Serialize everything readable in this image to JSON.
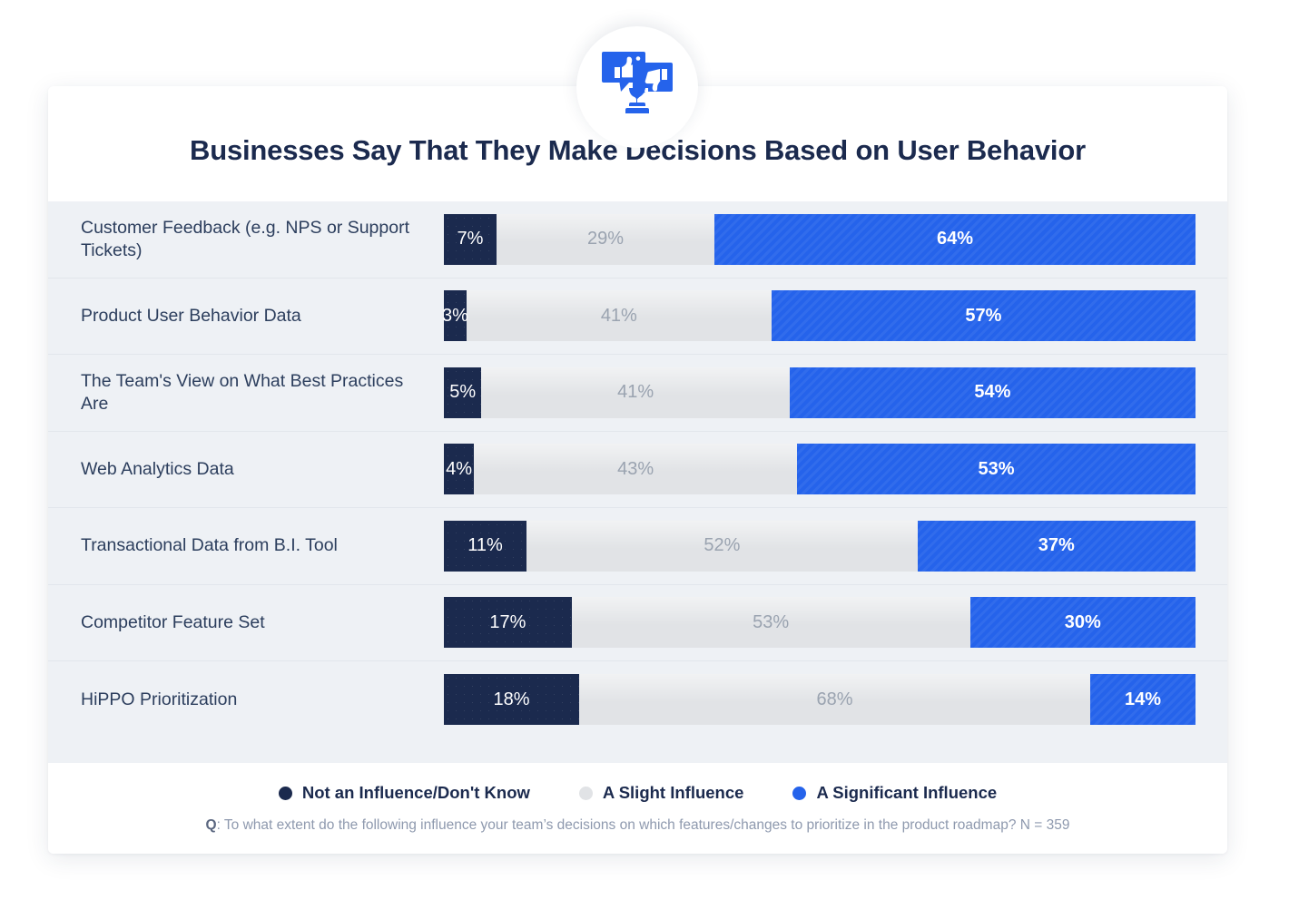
{
  "header": {
    "title": "Businesses Say That They Make Decisions Based on User Behavior",
    "badge_icon": "thumbs-up-down-feedback-icon"
  },
  "legend": {
    "items": [
      {
        "label": "Not an Influence/Don't Know",
        "color": "#1b2a4e",
        "icon": "legend-dot-not-an-influence"
      },
      {
        "label": "A Slight Influence",
        "color": "#e1e3e6",
        "icon": "legend-dot-slight-influence"
      },
      {
        "label": "A Significant Influence",
        "color": "#2563eb",
        "icon": "legend-dot-significant-influence"
      }
    ]
  },
  "footnote": {
    "prefix": "Q",
    "text": ": To what extent do the following influence your team’s decisions on which features/changes to prioritize in the product roadmap? N = 359"
  },
  "chart_data": {
    "type": "bar",
    "subtype": "stacked-horizontal-100",
    "title": "Businesses Say That They Make Decisions Based on User Behavior",
    "xlabel": "",
    "ylabel": "",
    "xlim": [
      0,
      100
    ],
    "grid": false,
    "legend_position": "bottom",
    "value_suffix": "%",
    "categories": [
      "Customer Feedback (e.g. NPS or Support Tickets)",
      "Product User Behavior Data",
      "The Team's View on What Best Practices Are",
      "Web Analytics Data",
      "Transactional Data from B.I. Tool",
      "Competitor Feature Set",
      "HiPPO Prioritization"
    ],
    "series": [
      {
        "name": "Not an Influence/Don't Know",
        "color": "#1b2a4e",
        "values": [
          7,
          3,
          5,
          4,
          11,
          17,
          18
        ]
      },
      {
        "name": "A Slight Influence",
        "color": "#e1e3e6",
        "values": [
          29,
          41,
          41,
          43,
          52,
          53,
          68
        ]
      },
      {
        "name": "A Significant Influence",
        "color": "#2563eb",
        "values": [
          64,
          57,
          54,
          53,
          37,
          30,
          14
        ]
      }
    ],
    "rows": [
      {
        "label": "Customer Feedback (e.g. NPS or Support Tickets)",
        "none": "7%",
        "slight": "29%",
        "significant": "64%",
        "none_v": 7,
        "slight_v": 29,
        "significant_v": 64
      },
      {
        "label": "Product User Behavior Data",
        "none": "3%",
        "slight": "41%",
        "significant": "57%",
        "none_v": 3,
        "slight_v": 41,
        "significant_v": 57
      },
      {
        "label": "The Team's View on What Best Practices Are",
        "none": "5%",
        "slight": "41%",
        "significant": "54%",
        "none_v": 5,
        "slight_v": 41,
        "significant_v": 54
      },
      {
        "label": "Web Analytics Data",
        "none": "4%",
        "slight": "43%",
        "significant": "53%",
        "none_v": 4,
        "slight_v": 43,
        "significant_v": 53
      },
      {
        "label": "Transactional Data from B.I. Tool",
        "none": "11%",
        "slight": "52%",
        "significant": "37%",
        "none_v": 11,
        "slight_v": 52,
        "significant_v": 37
      },
      {
        "label": "Competitor Feature Set",
        "none": "17%",
        "slight": "53%",
        "significant": "30%",
        "none_v": 17,
        "slight_v": 53,
        "significant_v": 30
      },
      {
        "label": "HiPPO Prioritization",
        "none": "18%",
        "slight": "68%",
        "significant": "14%",
        "none_v": 18,
        "slight_v": 68,
        "significant_v": 14
      }
    ]
  }
}
